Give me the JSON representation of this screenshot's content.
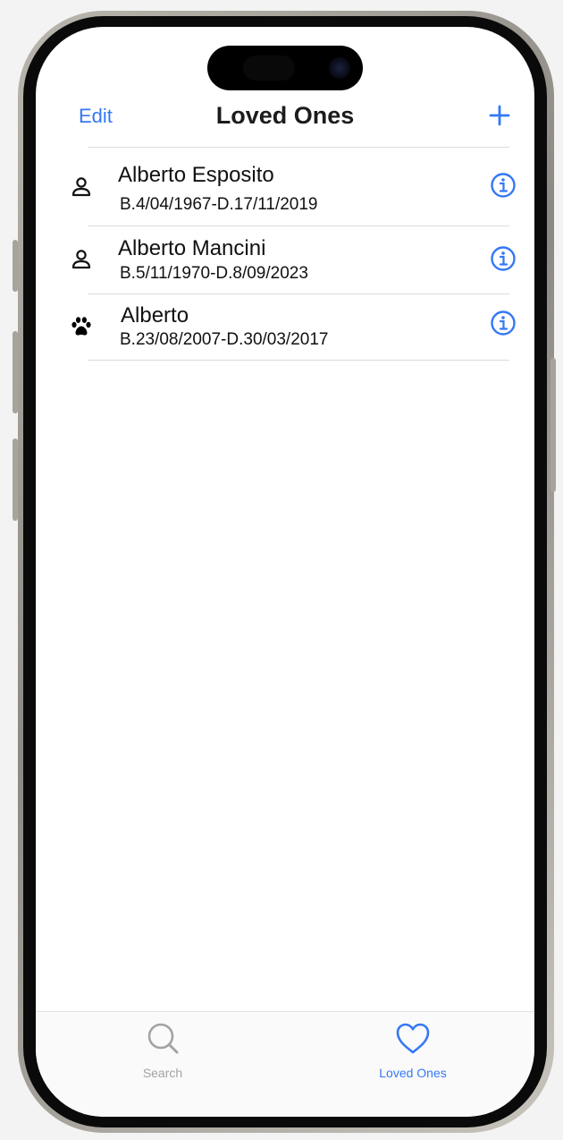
{
  "nav": {
    "edit_label": "Edit",
    "title": "Loved Ones",
    "add_icon": "plus-icon"
  },
  "loved_ones": [
    {
      "name": "Alberto Esposito",
      "dates": "B.4/04/1967-D.17/11/2019",
      "kind": "person",
      "icon": "person-icon"
    },
    {
      "name": "Alberto Mancini",
      "dates": "B.5/11/1970-D.8/09/2023",
      "kind": "person",
      "icon": "person-icon"
    },
    {
      "name": "Alberto",
      "dates": "B.23/08/2007-D.30/03/2017",
      "kind": "pet",
      "icon": "paw-icon"
    }
  ],
  "tabbar": {
    "tabs": [
      {
        "label": "Search",
        "icon": "search-icon",
        "active": false
      },
      {
        "label": "Loved Ones",
        "icon": "heart-icon",
        "active": true
      }
    ]
  },
  "colors": {
    "accent": "#3478f6",
    "inactive": "#a3a3a3",
    "text": "#111111"
  }
}
